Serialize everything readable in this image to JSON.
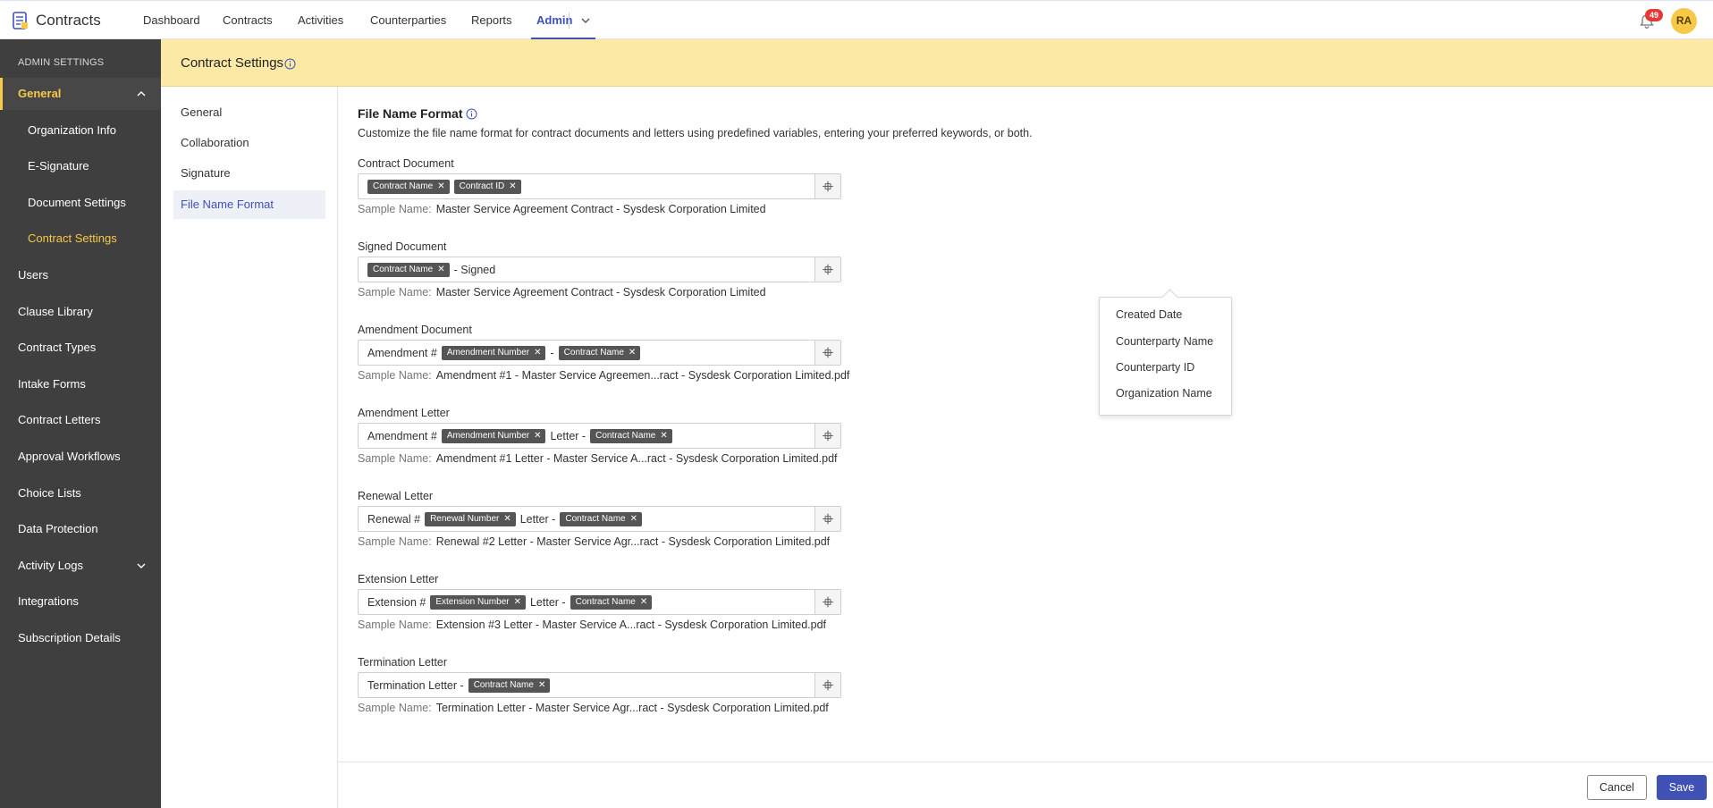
{
  "app": {
    "name": "Contracts"
  },
  "nav": {
    "items": [
      "Dashboard",
      "Contracts",
      "Activities",
      "Counterparties",
      "Reports",
      "Admin"
    ],
    "active": "Admin",
    "notification_count": "49",
    "avatar_initials": "RA"
  },
  "sidebar": {
    "heading": "ADMIN SETTINGS",
    "general": "General",
    "sub_items": [
      "Organization Info",
      "E-Signature",
      "Document Settings",
      "Contract Settings"
    ],
    "items": [
      "Users",
      "Clause Library",
      "Contract Types",
      "Intake Forms",
      "Contract Letters",
      "Approval Workflows",
      "Choice Lists",
      "Data Protection",
      "Activity Logs",
      "Integrations",
      "Subscription Details"
    ]
  },
  "banner": {
    "title": "Contract Settings"
  },
  "subnav": {
    "items": [
      "General",
      "Collaboration",
      "Signature",
      "File Name Format"
    ],
    "active": "File Name Format"
  },
  "section": {
    "title": "File Name Format",
    "description": "Customize the file name format for contract documents and letters using predefined variables, entering your preferred keywords, or both.",
    "sample_label": "Sample Name:"
  },
  "fields": [
    {
      "label": "Contract Document",
      "parts": [
        {
          "chip": "Contract Name"
        },
        {
          "chip": "Contract ID"
        }
      ],
      "sample": "Master Service Agreement Contract - Sysdesk Corporation Limited"
    },
    {
      "label": "Signed Document",
      "parts": [
        {
          "chip": "Contract Name"
        },
        {
          "text": "- Signed"
        }
      ],
      "sample": "Master Service Agreement Contract - Sysdesk Corporation Limited"
    },
    {
      "label": "Amendment Document",
      "parts": [
        {
          "text": "Amendment #"
        },
        {
          "chip": "Amendment Number"
        },
        {
          "text": "-"
        },
        {
          "chip": "Contract Name"
        }
      ],
      "sample": "Amendment #1 - Master Service Agreemen...ract - Sysdesk Corporation Limited.pdf"
    },
    {
      "label": "Amendment Letter",
      "parts": [
        {
          "text": "Amendment #"
        },
        {
          "chip": "Amendment Number"
        },
        {
          "text": "Letter -"
        },
        {
          "chip": "Contract Name"
        }
      ],
      "sample": "Amendment #1 Letter - Master Service A...ract - Sysdesk Corporation Limited.pdf"
    },
    {
      "label": "Renewal Letter",
      "parts": [
        {
          "text": "Renewal #"
        },
        {
          "chip": "Renewal Number"
        },
        {
          "text": "Letter -"
        },
        {
          "chip": "Contract Name"
        }
      ],
      "sample": "Renewal #2 Letter - Master Service Agr...ract - Sysdesk Corporation Limited.pdf"
    },
    {
      "label": "Extension Letter",
      "parts": [
        {
          "text": "Extension #"
        },
        {
          "chip": "Extension Number"
        },
        {
          "text": "Letter -"
        },
        {
          "chip": "Contract Name"
        }
      ],
      "sample": "Extension #3 Letter - Master Service A...ract - Sysdesk Corporation Limited.pdf"
    },
    {
      "label": "Termination Letter",
      "parts": [
        {
          "text": "Termination Letter -"
        },
        {
          "chip": "Contract Name"
        }
      ],
      "sample": "Termination Letter - Master Service Agr...ract - Sysdesk Corporation Limited.pdf"
    }
  ],
  "dropdown": {
    "options": [
      "Created Date",
      "Counterparty Name",
      "Counterparty ID",
      "Organization Name"
    ]
  },
  "footer": {
    "cancel_label": "Cancel",
    "save_label": "Save"
  },
  "colors": {
    "accent": "#3f51b5",
    "highlight": "#f7c948",
    "banner": "#fde9a6",
    "sidebar": "#3f3f3f"
  }
}
